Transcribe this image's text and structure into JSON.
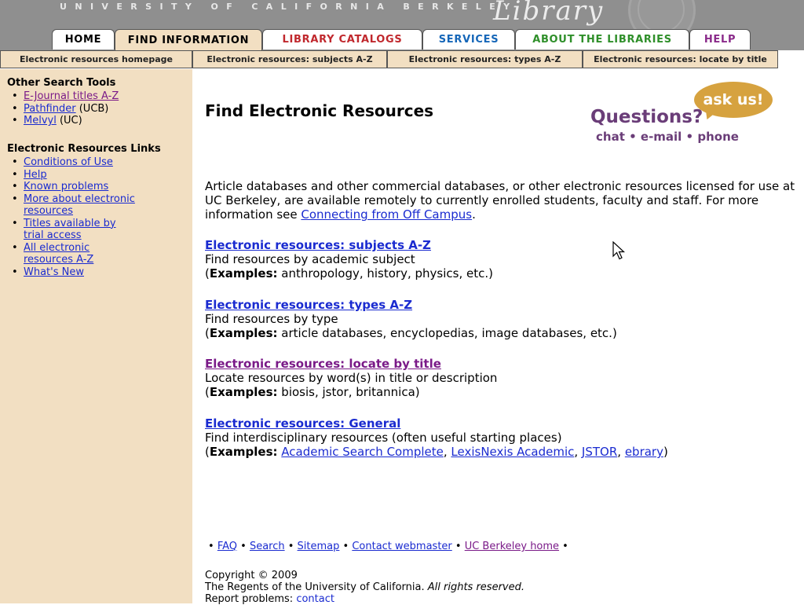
{
  "banner": {
    "university_text": "UNIVERSITY OF CALIFORNIA BERKELEY",
    "library_text": "Library"
  },
  "tabs": [
    {
      "label": "HOME",
      "color": "#000000"
    },
    {
      "label": "FIND INFORMATION",
      "color": "#000000"
    },
    {
      "label": "LIBRARY CATALOGS",
      "color": "#c0282d"
    },
    {
      "label": "SERVICES",
      "color": "#1566b8"
    },
    {
      "label": "ABOUT THE LIBRARIES",
      "color": "#2f8f2a"
    },
    {
      "label": "HELP",
      "color": "#8a2a8a"
    }
  ],
  "subnav": [
    "Electronic resources homepage",
    "Electronic resources: subjects A-Z",
    "Electronic resources: types A-Z",
    "Electronic resources: locate by title"
  ],
  "sidebar": {
    "other_tools_heading": "Other Search Tools",
    "other_tools": [
      {
        "link": "E-Journal titles A-Z",
        "suffix": ""
      },
      {
        "link": "Pathfinder",
        "suffix": " (UCB)"
      },
      {
        "link": "Melvyl",
        "suffix": " (UC)"
      }
    ],
    "links_heading": "Electronic Resources Links",
    "links": [
      "Conditions of Use",
      "Help",
      "Known problems",
      "More about electronic resources",
      "Titles available by trial access",
      "All electronic resources A-Z",
      "What's New"
    ]
  },
  "main": {
    "title": "Find Electronic Resources",
    "intro": "Article databases and other commercial databases, or other electronic resources licensed for use at UC Berkeley, are available remotely to currently enrolled students, faculty and staff. For more information see ",
    "intro_link": "Connecting from Off Campus",
    "intro_end": ".",
    "examples_label": "Examples:",
    "sections": [
      {
        "heading": "Electronic resources: subjects A-Z",
        "desc": "Find resources by academic subject",
        "examples": "anthropology, history, physics, etc."
      },
      {
        "heading": "Electronic resources: types A-Z",
        "desc": "Find resources by type",
        "examples": "article databases, encyclopedias, image databases, etc."
      },
      {
        "heading": "Electronic resources: locate by title",
        "desc": "Locate resources by word(s) in title or description",
        "examples": "biosis, jstor, britannica"
      },
      {
        "heading": "Electronic resources: General",
        "desc": "Find interdisciplinary resources (often useful starting places)",
        "example_links": [
          "Academic Search Complete",
          "LexisNexis Academic",
          "JSTOR",
          "ebrary"
        ]
      }
    ]
  },
  "ask": {
    "bubble": "ask us!",
    "questions": "Questions?",
    "options": "chat • e-mail • phone"
  },
  "footer": {
    "links": [
      "FAQ",
      "Search",
      "Sitemap",
      "Contact webmaster",
      "UC Berkeley home"
    ],
    "copyright_line1": "Copyright © 2009",
    "copyright_line2": "The Regents of the University of California.",
    "rights": "All rights reserved.",
    "report_label": "Report problems:",
    "report_link": "contact"
  }
}
